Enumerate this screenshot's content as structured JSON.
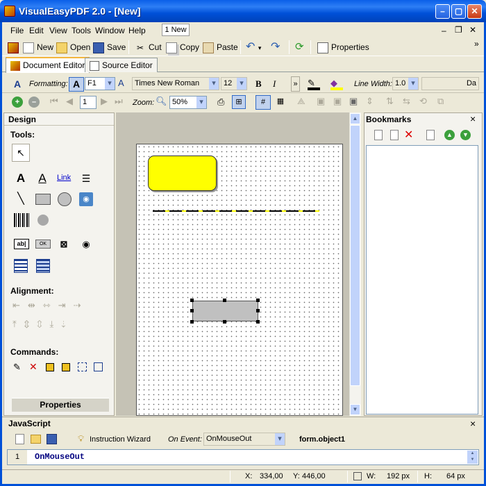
{
  "window": {
    "title": "VisualEasyPDF 2.0 - [New]",
    "min": "–",
    "max": "▢",
    "close": "✕"
  },
  "menu": {
    "items": [
      "File",
      "Edit",
      "View",
      "Tools",
      "Window",
      "Help"
    ],
    "doc_button": "1 New"
  },
  "toolbar": {
    "new": "New",
    "open": "Open",
    "save": "Save",
    "cut": "Cut",
    "copy": "Copy",
    "paste": "Paste",
    "properties": "Properties",
    "overflow": "»"
  },
  "tabs": [
    {
      "label": "Document Editor",
      "active": true
    },
    {
      "label": "Source Editor",
      "active": false
    }
  ],
  "formatting": {
    "label": "Formatting:",
    "style_value": "F1",
    "font_value": "Times New Roman",
    "size_value": "12",
    "bold": "B",
    "italic": "I",
    "line_width_label": "Line Width:",
    "line_width_value": "1.0",
    "dash_value": "Da"
  },
  "nav": {
    "page_value": "1",
    "zoom_label": "Zoom:",
    "zoom_value": "50%"
  },
  "design": {
    "title": "Design",
    "tools_label": "Tools:",
    "link_label": "Link",
    "alignment_label": "Alignment:",
    "commands_label": "Commands:",
    "properties_button": "Properties",
    "field_text": "ab|",
    "field_button": "OK"
  },
  "bookmarks": {
    "title": "Bookmarks",
    "close": "×"
  },
  "javascript": {
    "title": "JavaScript",
    "close": "×",
    "wizard_label": "Instruction Wizard",
    "event_label": "On Event:",
    "event_value": "OnMouseOut",
    "object_label": "form.object1",
    "line_number": "1",
    "code": "OnMouseOut"
  },
  "status": {
    "x_label": "X:",
    "x_value": "334,00",
    "y_label": "Y:",
    "y_value": "446,00",
    "w_label": "W:",
    "w_value": "192 px",
    "h_label": "H:",
    "h_value": "64 px"
  },
  "colors": {
    "title_blue": "#0054e3",
    "accent_yellow": "#ffff00",
    "selected_gray": "#c0c0c0",
    "panel": "#ece9d8"
  }
}
